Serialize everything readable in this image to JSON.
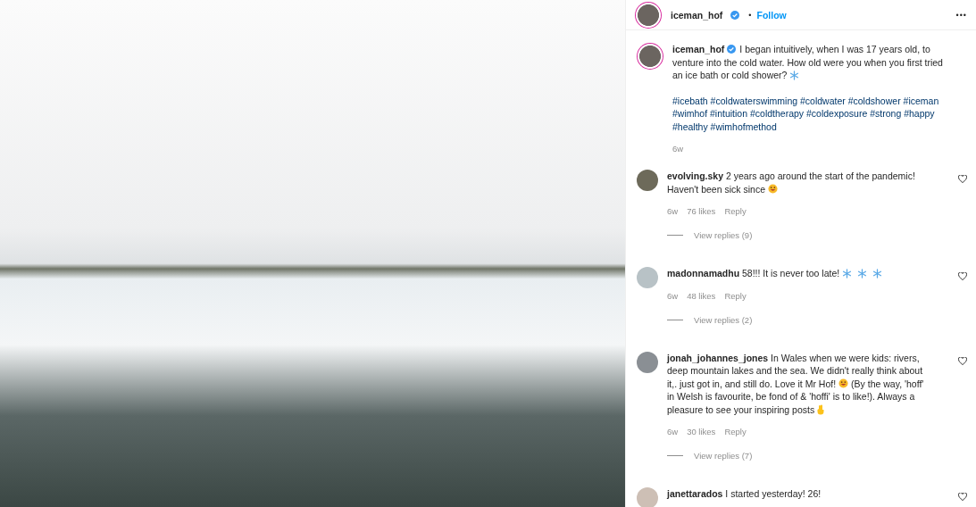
{
  "post": {
    "username": "iceman_hof",
    "verified": true,
    "separator": "•",
    "follow": "Follow",
    "more": "•••"
  },
  "caption": {
    "username": "iceman_hof",
    "verified": true,
    "lines": [
      {
        "segments": [
          {
            "kind": "text",
            "text": "I began intuitively, when I was 17 years old, to"
          }
        ]
      },
      {
        "segments": [
          {
            "kind": "text",
            "text": "venture into the cold water. How old were you when you first tried"
          }
        ]
      },
      {
        "segments": [
          {
            "kind": "text",
            "text": "an ice bath or cold shower?"
          },
          {
            "kind": "snowflake"
          }
        ]
      }
    ],
    "hashtags": "#icebath #coldwaterswimming #coldwater #coldshower #iceman #wimhof #intuition #coldtherapy #coldexposure #strong #happy #healthy #wimhofmethod",
    "time": "6w"
  },
  "comments": [
    {
      "lines": [
        {
          "segments": [
            {
              "kind": "text",
              "text": "**evolving.sky** 2 years ago around the start of the pandemic!"
            }
          ]
        },
        {
          "segments": [
            {
              "kind": "text",
              "text": "Haven't been sick since"
            },
            {
              "kind": "smiley"
            }
          ]
        }
      ],
      "time": "6w",
      "likes": "76 likes",
      "reply": "Reply",
      "view_replies": "View replies (9)",
      "liked": false
    },
    {
      "lines": [
        {
          "segments": [
            {
              "kind": "text",
              "text": "**madonnamadhu** 58!!! It is never too late!"
            },
            {
              "kind": "snowflake"
            },
            {
              "kind": "snowflake"
            },
            {
              "kind": "snowflake"
            }
          ]
        }
      ],
      "time": "6w",
      "likes": "48 likes",
      "reply": "Reply",
      "view_replies": "View replies (2)",
      "liked": false
    },
    {
      "lines": [
        {
          "segments": [
            {
              "kind": "text",
              "text": "**jonah_johannes_jones** In Wales when we were kids: rivers,"
            }
          ]
        },
        {
          "segments": [
            {
              "kind": "text",
              "text": "deep mountain lakes and the sea. We didn't really think about"
            }
          ]
        },
        {
          "segments": [
            {
              "kind": "text",
              "text": "it,. just got in, and still do. Love it Mr Hof!"
            },
            {
              "kind": "smiley"
            },
            {
              "kind": "text",
              "text": "(By the way, 'hoff'"
            }
          ]
        },
        {
          "segments": [
            {
              "kind": "text",
              "text": "in Welsh is favourite, be fond of & 'hoffi' is to like!). Always a"
            }
          ]
        },
        {
          "segments": [
            {
              "kind": "text",
              "text": "pleasure to see your inspiring posts"
            },
            {
              "kind": "hand"
            }
          ]
        }
      ],
      "time": "6w",
      "likes": "30 likes",
      "reply": "Reply",
      "view_replies": "View replies (7)",
      "liked": false
    },
    {
      "lines": [
        {
          "segments": [
            {
              "kind": "text",
              "text": "**janettarados** I started yesterday! 26!"
            }
          ]
        }
      ],
      "liked": false
    }
  ]
}
